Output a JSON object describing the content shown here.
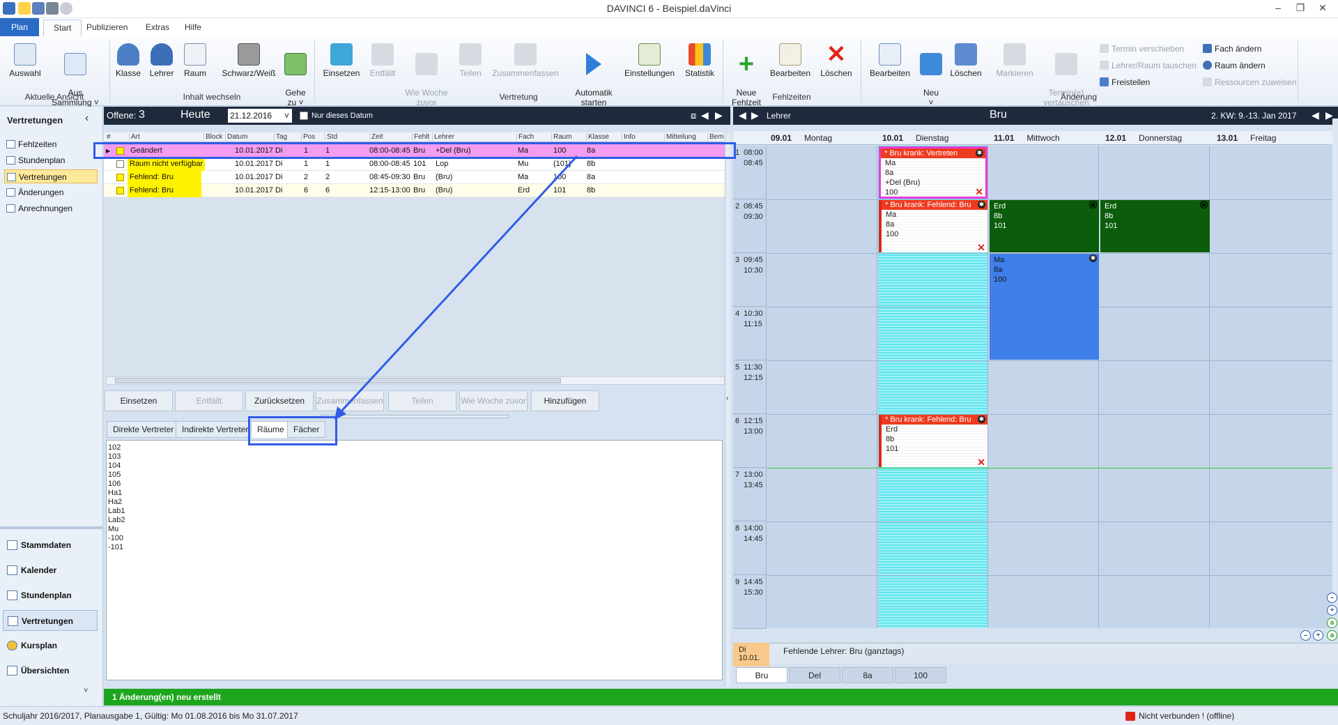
{
  "window": {
    "title": "DAVINCI 6 - Beispiel.daVinci",
    "controls": [
      "–",
      "❐",
      "✕"
    ]
  },
  "ribbon_tabs": [
    "Plan",
    "Start",
    "Publizieren",
    "Extras",
    "Hilfe"
  ],
  "ribbon": {
    "groups": {
      "aktuelle_ansicht": "Aktuelle Ansicht",
      "inhalt_wechseln": "Inhalt wechseln",
      "vertretung": "Vertretung",
      "fehlzeiten": "Fehlzeiten",
      "aenderung": "Änderung"
    },
    "buttons": {
      "auswahl": "Auswahl",
      "aus_sammlung": "Aus\nSammlung ˅",
      "klasse": "Klasse",
      "lehrer": "Lehrer",
      "raum": "Raum",
      "schwarz_weiss": "Schwarz/Weiß",
      "gehe_zu": "Gehe\nzu ˅",
      "einsetzen": "Einsetzen",
      "entfaellt": "Entfällt",
      "wie_woche_zuvor": "Wie Woche\nzuvor",
      "teilen": "Teilen",
      "zusammenfassen": "Zusammenfassen",
      "automatik_starten": "Automatik\nstarten",
      "einstellungen": "Einstellungen",
      "statistik": "Statistik",
      "neue_fehlzeit": "Neue\nFehlzeit",
      "bearbeiten": "Bearbeiten",
      "loeschen": "Löschen",
      "bearbeiten2": "Bearbeiten",
      "neu": "Neu\n˅",
      "loeschen2": "Löschen",
      "markieren": "Markieren",
      "termine_vertauschen": "Termin(e)\nvertauschen"
    },
    "small_buttons": {
      "termin_verschieben": "Termin verschieben",
      "lehrer_raum_tauschen": "Lehrer/Raum tauschen",
      "freistellen": "Freistellen",
      "fach_aendern": "Fach ändern",
      "raum_aendern": "Raum ändern",
      "ressourcen_zuweisen": "Ressourcen zuweisen"
    }
  },
  "sidebar": {
    "title": "Vertretungen",
    "collapse": "‹",
    "items": [
      "Fehlzeiten",
      "Stundenplan",
      "Vertretungen",
      "Änderungen",
      "Anrechnungen"
    ],
    "bottom": [
      "Stammdaten",
      "Kalender",
      "Stundenplan",
      "Vertretungen",
      "Kursplan",
      "Übersichten"
    ],
    "more": "˅"
  },
  "subst": {
    "offene_label": "Offene:",
    "offene_count": "3",
    "heute": "Heute",
    "date": "21.12.2016",
    "date_dropdown": "˅",
    "nur_dieses_datum": "Nur dieses Datum",
    "columns": [
      "#",
      "Art",
      "Block",
      "Datum",
      "Tag",
      "Pos",
      "Std",
      "Zeit",
      "Fehlt",
      "Lehrer",
      "Fach",
      "Raum",
      "Klasse",
      "Info",
      "Mitteilung",
      "Bem"
    ],
    "rows": [
      {
        "art": "Geändert",
        "datum": "10.01.2017",
        "tag": "Di",
        "pos": "1",
        "std": "1",
        "zeit": "08:00-08:45",
        "fehlt": "Bru",
        "lehrer": "+Del (Bru)",
        "fach": "Ma",
        "raum": "100",
        "klasse": "8a"
      },
      {
        "art": "Raum nicht verfügbar",
        "datum": "10.01.2017",
        "tag": "Di",
        "pos": "1",
        "std": "1",
        "zeit": "08:00-08:45",
        "fehlt": "101",
        "lehrer": "Lop",
        "fach": "Mu",
        "raum": "(101)",
        "klasse": "8b"
      },
      {
        "art": "Fehlend: Bru",
        "datum": "10.01.2017",
        "tag": "Di",
        "pos": "2",
        "std": "2",
        "zeit": "08:45-09:30",
        "fehlt": "Bru",
        "lehrer": "(Bru)",
        "fach": "Ma",
        "raum": "100",
        "klasse": "8a"
      },
      {
        "art": "Fehlend: Bru",
        "datum": "10.01.2017",
        "tag": "Di",
        "pos": "6",
        "std": "6",
        "zeit": "12:15-13:00",
        "fehlt": "Bru",
        "lehrer": "(Bru)",
        "fach": "Erd",
        "raum": "101",
        "klasse": "8b"
      }
    ],
    "actions": [
      "Einsetzen",
      "Entfällt",
      "Zurücksetzen",
      "Zusammenfassen",
      "Teilen",
      "Wie Woche zuvor",
      "Hinzufügen"
    ],
    "subtabs": [
      "Direkte Vertreter",
      "Indirekte Vertreter",
      "Räume",
      "Fächer"
    ],
    "rooms": [
      "102",
      "103",
      "104",
      "105",
      "106",
      "Ha1",
      "Ha2",
      "Lab1",
      "Lab2",
      "Mu",
      "-100",
      "-101"
    ]
  },
  "status_green": "1 Änderung(en) neu erstellt",
  "statusbar": {
    "left": "Schuljahr 2016/2017, Planausgabe 1, Gültig: Mo 01.08.2016 bis Mo 31.07.2017",
    "right": "Nicht verbunden ! (offline)"
  },
  "calendar": {
    "mode": "Lehrer",
    "name": "Bru",
    "week": "2. KW: 9.-13. Jan 2017",
    "days": [
      {
        "date": "09.01",
        "name": "Montag"
      },
      {
        "date": "10.01",
        "name": "Dienstag"
      },
      {
        "date": "11.01",
        "name": "Mittwoch"
      },
      {
        "date": "12.01",
        "name": "Donnerstag"
      },
      {
        "date": "13.01",
        "name": "Freitag"
      }
    ],
    "hours": [
      {
        "n": "1",
        "from": "08:00",
        "to": "08:45"
      },
      {
        "n": "2",
        "from": "08:45",
        "to": "09:30"
      },
      {
        "n": "3",
        "from": "09:45",
        "to": "10:30"
      },
      {
        "n": "4",
        "from": "10:30",
        "to": "11:15"
      },
      {
        "n": "5",
        "from": "11:30",
        "to": "12:15"
      },
      {
        "n": "6",
        "from": "12:15",
        "to": "13:00"
      },
      {
        "n": "7",
        "from": "13:00",
        "to": "13:45"
      },
      {
        "n": "8",
        "from": "14:00",
        "to": "14:45"
      },
      {
        "n": "9",
        "from": "14:45",
        "to": "15:30"
      }
    ],
    "events": {
      "e1": {
        "head": "* Bru krank: Vertreten",
        "l1": "Ma",
        "l2": "8a",
        "l3": "+Del (Bru)",
        "l4": "100"
      },
      "e2": {
        "head": "* Bru krank: Fehlend: Bru",
        "l1": "Ma",
        "l2": "8a",
        "l3": "100"
      },
      "e3": {
        "head": "* Bru krank: Fehlend: Bru",
        "l1": "Erd",
        "l2": "8b",
        "l3": "101"
      },
      "e4": {
        "l1": "Erd",
        "l2": "8b",
        "l3": "101"
      },
      "e5": {
        "l1": "Erd",
        "l2": "8b",
        "l3": "101"
      },
      "e6": {
        "l1": "Ma",
        "l2": "8a",
        "l3": "100"
      }
    },
    "info_date": "Di 10.01.",
    "info_text": "Fehlende Lehrer: Bru (ganztags)",
    "bottom_tabs": [
      "Bru",
      "Del",
      "8a",
      "100"
    ]
  },
  "colors": {
    "highlight_row": "#f49cf0",
    "yellow": "#fff200",
    "event_red": "#ee3b1f",
    "event_green": "#0b5d0b",
    "event_blue": "#3f7fe9",
    "cyan_stripes": "#63e3ef",
    "status_green": "#1ea51e",
    "annotation_blue": "#2f5ce8"
  }
}
